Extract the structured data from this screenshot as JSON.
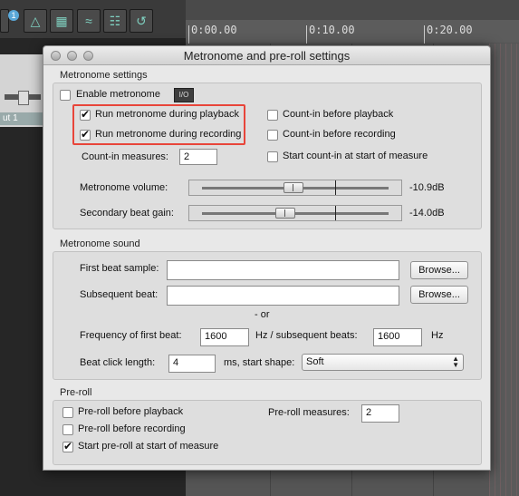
{
  "background": {
    "ruler_ticks": [
      "0:00.00",
      "0:10.00",
      "0:20.00"
    ],
    "track_label": "ut 1",
    "toolbar_badge": "1"
  },
  "dialog": {
    "title": "Metronome and pre-roll settings",
    "metronome_settings": {
      "section_label": "Metronome settings",
      "enable_metronome": {
        "label": "Enable metronome",
        "checked": false
      },
      "io_button": "I/O",
      "run_during_playback": {
        "label": "Run metronome during playback",
        "checked": true
      },
      "run_during_recording": {
        "label": "Run metronome during recording",
        "checked": true
      },
      "count_in_playback": {
        "label": "Count-in before playback",
        "checked": false
      },
      "count_in_recording": {
        "label": "Count-in before recording",
        "checked": false
      },
      "count_in_measures_label": "Count-in measures:",
      "count_in_measures_value": "2",
      "start_count_in": {
        "label": "Start count-in at start of measure",
        "checked": false
      },
      "volume_label": "Metronome volume:",
      "volume_value": "-10.9dB",
      "secondary_label": "Secondary beat gain:",
      "secondary_value": "-14.0dB"
    },
    "metronome_sound": {
      "section_label": "Metronome sound",
      "first_beat_label": "First beat sample:",
      "first_beat_value": "",
      "browse_label": "Browse...",
      "subsequent_label": "Subsequent beat:",
      "subsequent_value": "",
      "or_text": "- or",
      "freq_first_label": "Frequency of first beat:",
      "freq_first_value": "1600",
      "freq_sub_label": "Hz / subsequent beats:",
      "freq_sub_value": "1600",
      "hz_label": "Hz",
      "click_length_label": "Beat click length:",
      "click_length_value": "4",
      "start_shape_label": "ms, start shape:",
      "start_shape_value": "Soft"
    },
    "preroll": {
      "section_label": "Pre-roll",
      "before_playback": {
        "label": "Pre-roll before playback",
        "checked": false
      },
      "before_recording": {
        "label": "Pre-roll before recording",
        "checked": false
      },
      "start_at_measure": {
        "label": "Start pre-roll at start of measure",
        "checked": true
      },
      "measures_label": "Pre-roll measures:",
      "measures_value": "2"
    }
  },
  "colors": {
    "highlight": "#e8453a"
  }
}
